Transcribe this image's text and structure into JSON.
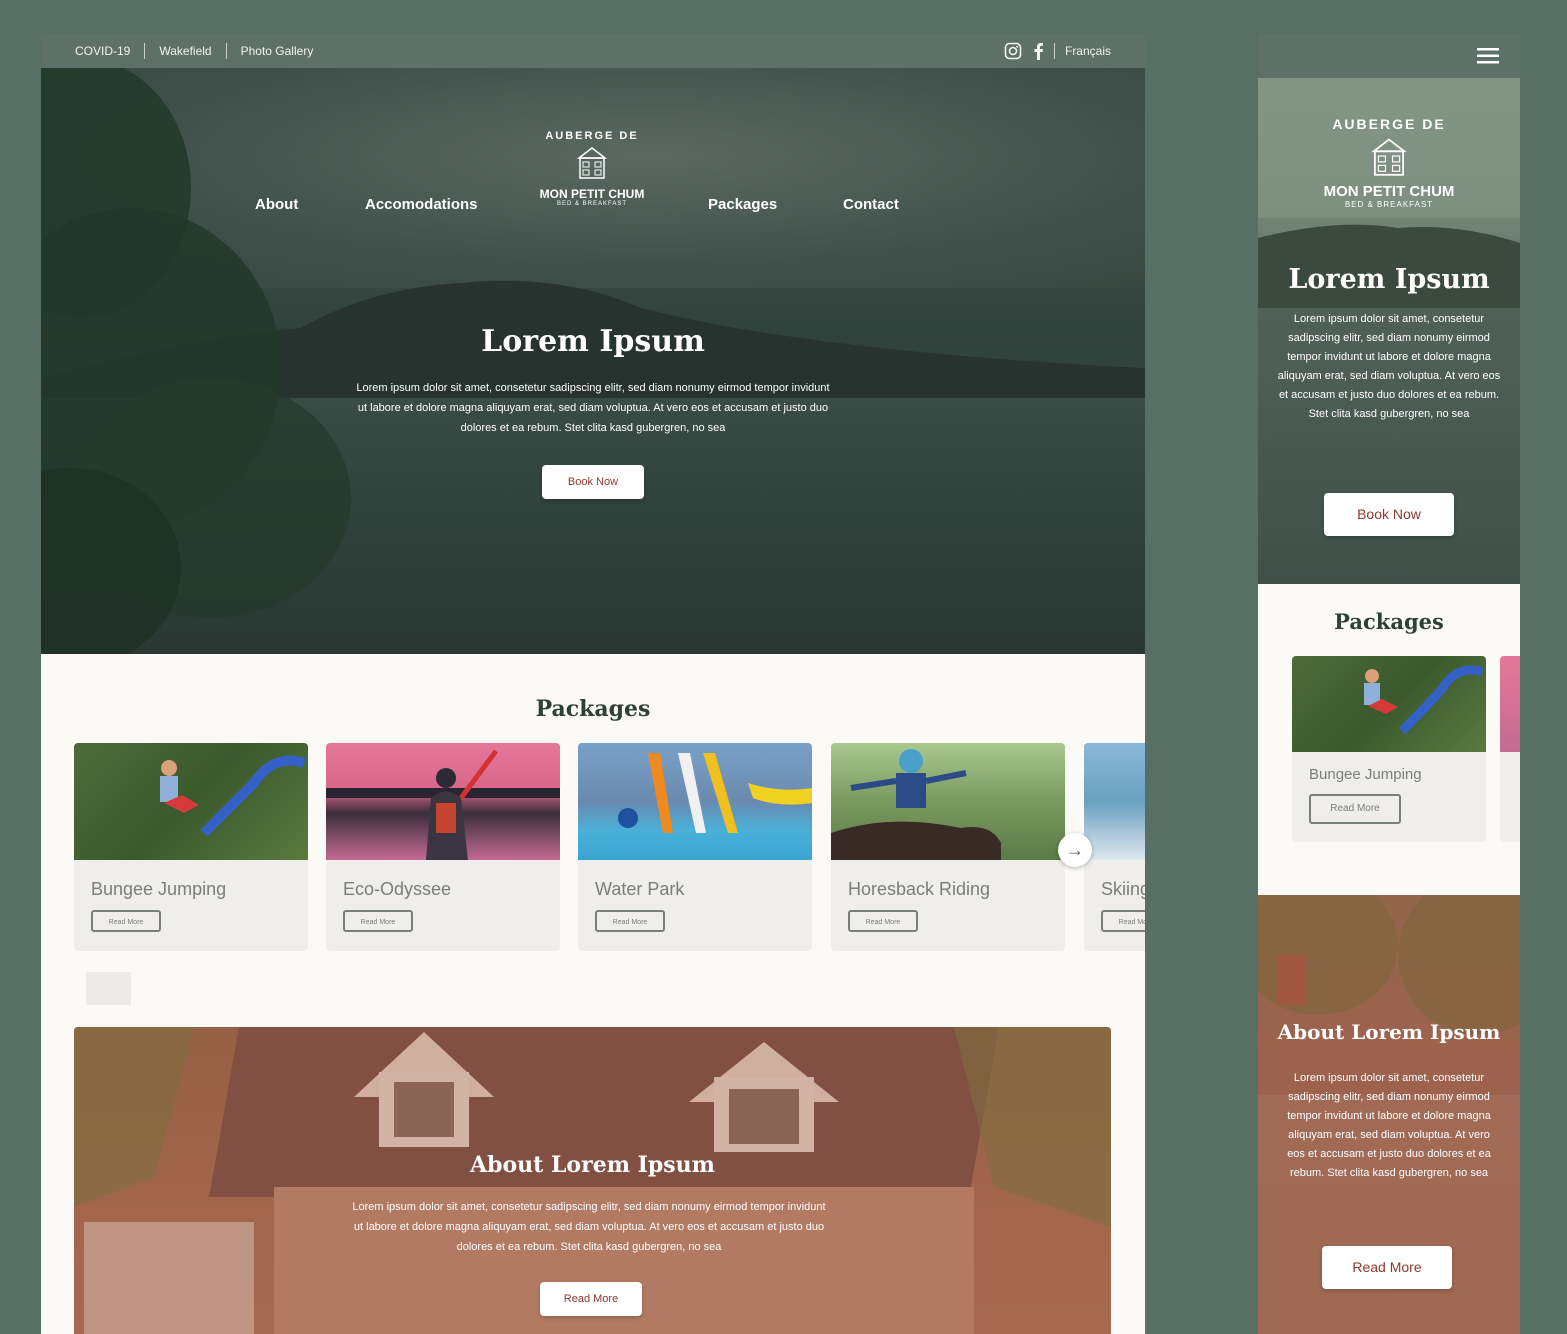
{
  "topbar": {
    "links": [
      "COVID-19",
      "Wakefield",
      "Photo Gallery"
    ],
    "language": "Français",
    "icons": [
      "instagram-icon",
      "facebook-icon"
    ]
  },
  "logo": {
    "arc_text": "AUBERGE DE",
    "name": "MON PETIT CHUM",
    "subtitle": "BED & BREAKFAST"
  },
  "nav": {
    "about": "About",
    "accommodations": "Accomodations",
    "packages": "Packages",
    "contact": "Contact"
  },
  "hero": {
    "title": "Lorem Ipsum",
    "text": "Lorem ipsum dolor sit amet, consetetur sadipscing elitr, sed diam nonumy eirmod tempor invidunt ut labore et dolore magna aliquyam erat, sed diam voluptua. At vero eos et accusam et justo duo dolores et ea rebum. Stet clita kasd gubergren, no sea",
    "button": "Book Now"
  },
  "packages": {
    "title": "Packages",
    "cards": [
      {
        "title": "Bungee Jumping",
        "button": "Read More"
      },
      {
        "title": "Eco-Odyssee",
        "button": "Read More"
      },
      {
        "title": "Water Park",
        "button": "Read More"
      },
      {
        "title": "Horesback Riding",
        "button": "Read More"
      },
      {
        "title": "Skiing",
        "button": "Read More"
      }
    ]
  },
  "about": {
    "title": "About Lorem Ipsum",
    "text": "Lorem ipsum dolor sit amet, consetetur sadipscing elitr, sed diam nonumy eirmod tempor invidunt ut labore et dolore magna aliquyam erat, sed diam voluptua. At vero eos et accusam et justo duo dolores et ea rebum. Stet clita kasd gubergren, no sea",
    "button": "Read More"
  },
  "mobile": {
    "menu_icon": "hamburger-icon",
    "card_title": "Bungee Jumping",
    "card_button": "Read More"
  },
  "colors": {
    "topbar": "#5d7169",
    "page_bg": "#586f66",
    "accent_text": "#8b3a2e",
    "card_bg": "#efeeea"
  }
}
